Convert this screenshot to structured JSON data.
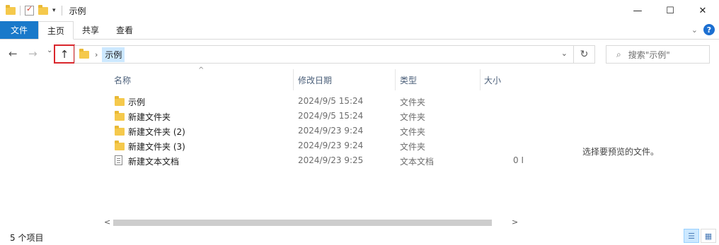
{
  "window": {
    "title": "示例",
    "minimize": "—",
    "maximize": "☐",
    "close": "✕"
  },
  "qat": {
    "dropdown": "▾"
  },
  "ribbon": {
    "tabs": [
      {
        "label": "文件"
      },
      {
        "label": "主页"
      },
      {
        "label": "共享"
      },
      {
        "label": "查看"
      }
    ],
    "collapse": "⌄",
    "help": "?"
  },
  "nav": {
    "back": "←",
    "forward": "→",
    "recent": "⌄",
    "up": "↑",
    "address_sep": "›",
    "address_crumb": "示例",
    "address_dropdown": "⌄",
    "refresh": "↻",
    "search_placeholder": "搜索\"示例\"",
    "search_icon": "⌕"
  },
  "columns": {
    "name": "名称",
    "date": "修改日期",
    "type": "类型",
    "size": "大小",
    "sort_indicator": "^"
  },
  "files": [
    {
      "name": "示例",
      "date": "2024/9/5 15:24",
      "type": "文件夹",
      "size": "",
      "icon": "folder-icon"
    },
    {
      "name": "新建文件夹",
      "date": "2024/9/5 15:24",
      "type": "文件夹",
      "size": "",
      "icon": "folder-icon"
    },
    {
      "name": "新建文件夹 (2)",
      "date": "2024/9/23 9:24",
      "type": "文件夹",
      "size": "",
      "icon": "folder-icon"
    },
    {
      "name": "新建文件夹 (3)",
      "date": "2024/9/23 9:24",
      "type": "文件夹",
      "size": "",
      "icon": "folder-icon"
    },
    {
      "name": "新建文本文档",
      "date": "2024/9/23 9:25",
      "type": "文本文档",
      "size": "0 I",
      "icon": "text-document-icon"
    }
  ],
  "scroll": {
    "left": "<",
    "right": ">"
  },
  "preview_text": "选择要预览的文件。",
  "status": {
    "item_count": "5 个项目"
  },
  "view": {
    "details": "☰",
    "tiles": "▦"
  },
  "colors": {
    "accent": "#1979ca",
    "highlight": "#d9262c",
    "folder": "#f5c94c"
  }
}
